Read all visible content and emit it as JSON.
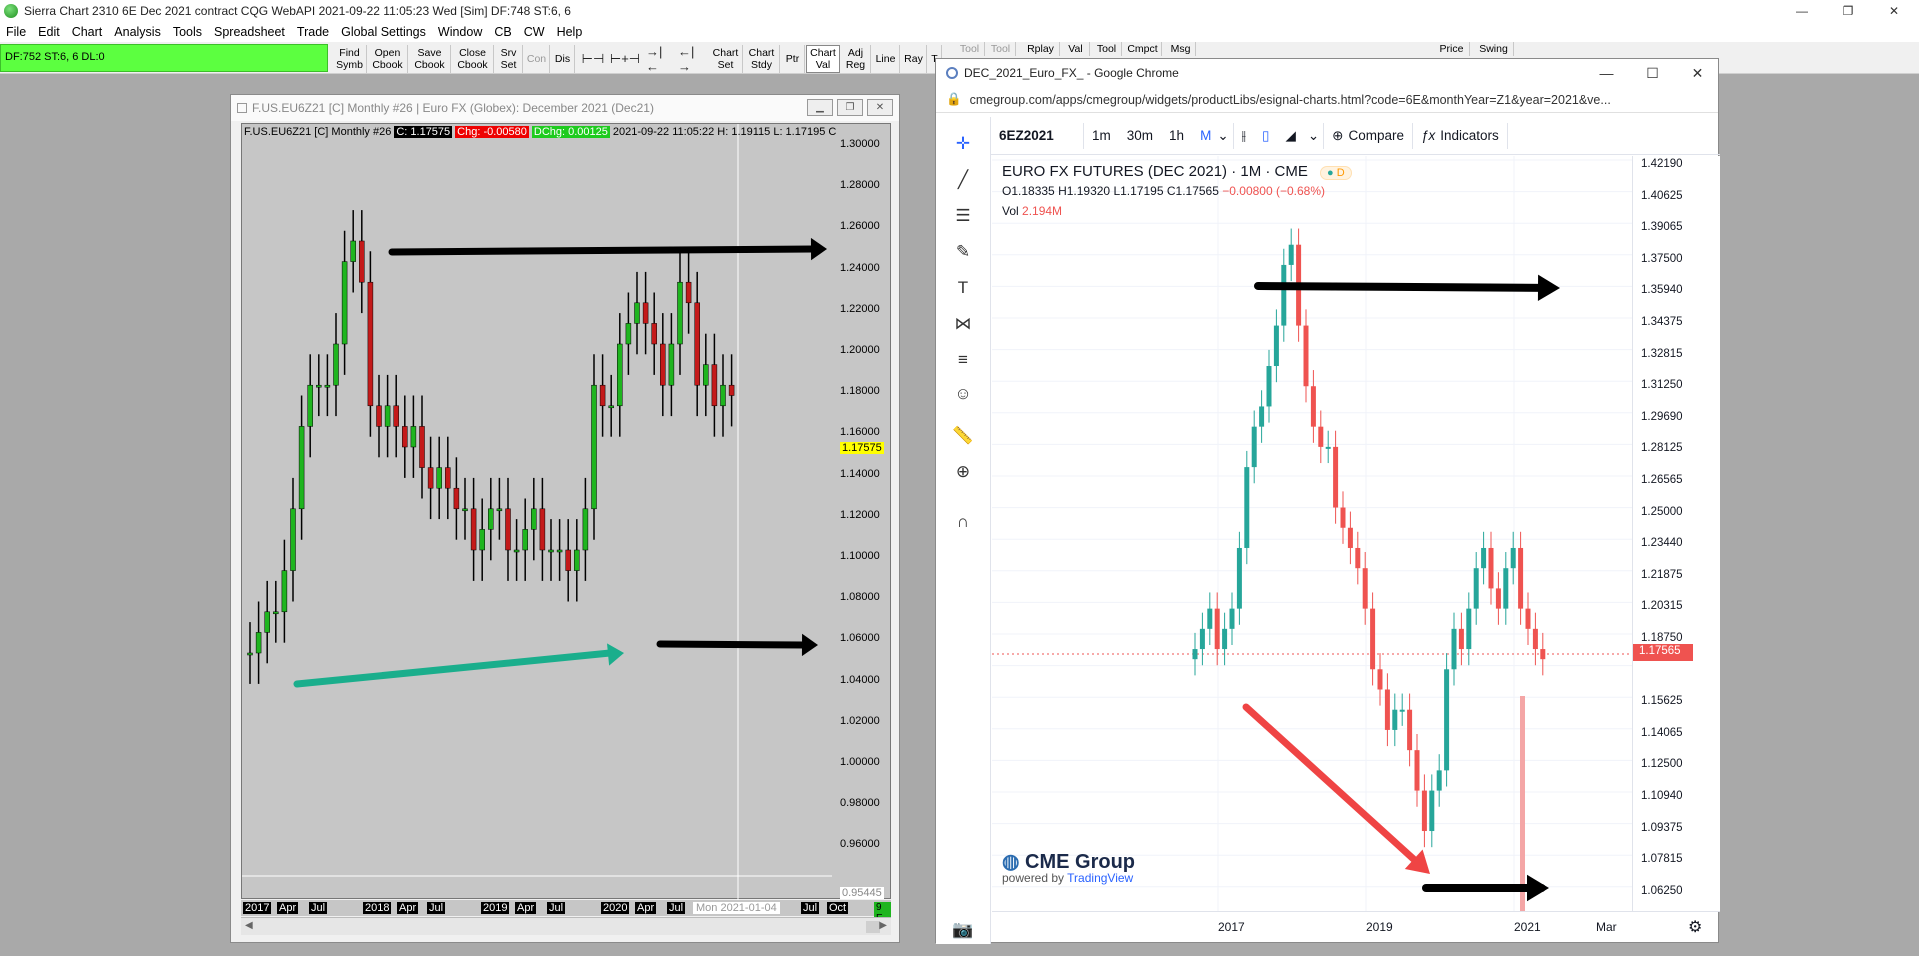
{
  "app": {
    "title": "Sierra Chart 2310 6E  Dec 2021 contract  CQG WebAPI 2021-09-22  11:05:23 Wed [Sim]  DF:748  ST:6, 6",
    "win_controls": [
      "—",
      "❐",
      "✕"
    ]
  },
  "menu": [
    "File",
    "Edit",
    "Chart",
    "Analysis",
    "Tools",
    "Spreadsheet",
    "Trade",
    "Global Settings",
    "Window",
    "CB",
    "CW",
    "Help"
  ],
  "status_box": "DF:752  ST:6, 6  DL:0",
  "toolbar": {
    "buttons": [
      "Find\nSymb",
      "Open\nCbook",
      "Save\nCbook",
      "Close\nCbook",
      "Srv\nSet",
      "Con",
      "Dis"
    ],
    "buttons2": [
      "Chart\nSet",
      "Chart\nStdy",
      "Ptr",
      "Chart\nVal",
      "Adj\nReg",
      "Line",
      "Ray",
      "T",
      "Tool",
      "Tool",
      "Rplay",
      "Val",
      "Tool",
      "Cmpct",
      "Msg",
      "Price",
      "Swing"
    ]
  },
  "sierra_window": {
    "title": "F.US.EU6Z21 [C]  Monthly  #26 | Euro FX (Globex): December 2021 (Dec21)",
    "header": {
      "symbol": "F.US.EU6Z21 [C]  Monthly  #26",
      "close": "C: 1.17575",
      "chg": "Chg: -0.00580",
      "dchg": "DChg: 0.00125",
      "rest": "2021-09-22 11:05:22 H: 1.19115 L: 1.17195 C"
    },
    "y_labels": [
      "1.30000",
      "1.28000",
      "1.26000",
      "1.24000",
      "1.22000",
      "1.20000",
      "1.18000",
      "1.16000",
      "1.14000",
      "1.12000",
      "1.10000",
      "1.08000",
      "1.06000",
      "1.04000",
      "1.02000",
      "1.00000",
      "0.98000",
      "0.96000"
    ],
    "last_price": "1.17575",
    "bottom_label": "0.95445",
    "x_labels": [
      "2017",
      "Apr",
      "Jul",
      "2018",
      "Apr",
      "Jul",
      "2019",
      "Apr",
      "Jul",
      "2020",
      "Apr",
      "Jul",
      "Jul",
      "Oct"
    ],
    "cursor_date": "Mon 2021-01-04",
    "corner": "9 E"
  },
  "chrome_window": {
    "title": "DEC_2021_Euro_FX_ - Google Chrome",
    "url": "cmegroup.com/apps/cmegroup/widgets/productLibs/esignal-charts.html?code=6E&monthYear=Z1&year=2021&ve...",
    "controls": [
      "—",
      "☐",
      "✕"
    ],
    "tv_toolbar": {
      "symbol": "6EZ2021",
      "intervals": [
        "1m",
        "30m",
        "1h",
        "M"
      ],
      "compare": "Compare",
      "indicators": "Indicators"
    },
    "legend": {
      "title": "EURO FX FUTURES (DEC 2021) · 1M · CME",
      "badge": "D",
      "o": "O1.18335",
      "h": "H1.19320",
      "l": "L1.17195",
      "c": "C1.17565",
      "chg": "−0.00800 (−0.68%)",
      "vol_label": "Vol",
      "vol": "2.194M"
    },
    "y_labels": [
      "1.42190",
      "1.40625",
      "1.39065",
      "1.37500",
      "1.35940",
      "1.34375",
      "1.32815",
      "1.31250",
      "1.29690",
      "1.28125",
      "1.26565",
      "1.25000",
      "1.23440",
      "1.21875",
      "1.20315",
      "1.18750",
      "1.17565",
      "1.15625",
      "1.14065",
      "1.12500",
      "1.10940",
      "1.09375",
      "1.07815",
      "1.06250"
    ],
    "last_price": "1.17565",
    "x_labels": [
      "2017",
      "2019",
      "2021",
      "Mar"
    ],
    "logo": "CME Group",
    "powered": "powered by",
    "tradingview": "TradingView"
  },
  "colors": {
    "up": "#1fb51f",
    "down": "#c41a1a",
    "tv_up": "#26a69a",
    "tv_down": "#ef5350",
    "status_green": "#5cff40"
  }
}
